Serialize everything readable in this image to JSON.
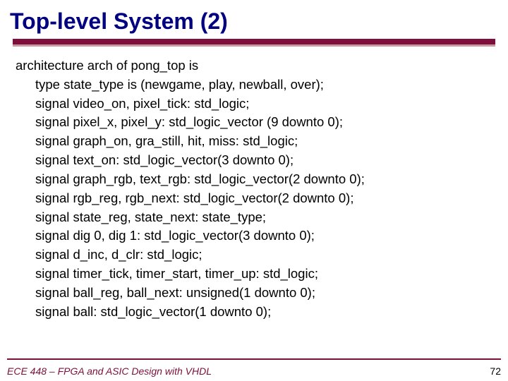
{
  "title": "Top-level System (2)",
  "code": {
    "l0": "architecture arch of pong_top is",
    "l1": "type state_type is (newgame, play, newball, over);",
    "l2": "signal video_on, pixel_tick: std_logic;",
    "l3": "signal pixel_x, pixel_y: std_logic_vector (9 downto 0);",
    "l4": "signal graph_on, gra_still, hit, miss: std_logic;",
    "l5": "signal text_on: std_logic_vector(3 downto 0);",
    "l6": "signal graph_rgb, text_rgb: std_logic_vector(2 downto 0);",
    "l7": "signal rgb_reg, rgb_next: std_logic_vector(2 downto 0);",
    "l8": "signal state_reg, state_next: state_type;",
    "l9": "signal dig 0, dig 1: std_logic_vector(3 downto 0);",
    "l10": "signal d_inc, d_clr: std_logic;",
    "l11": "signal timer_tick, timer_start, timer_up: std_logic;",
    "l12": "signal ball_reg, ball_next: unsigned(1 downto 0);",
    "l13": "signal ball: std_logic_vector(1 downto 0);"
  },
  "footer": {
    "course": "ECE 448 – FPGA and ASIC Design with VHDL",
    "page": "72"
  }
}
